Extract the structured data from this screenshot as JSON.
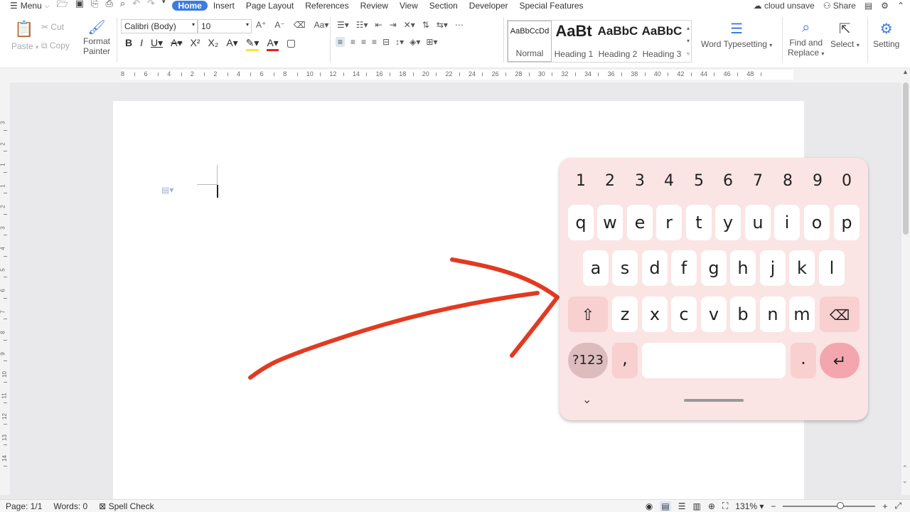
{
  "menubar": {
    "menu_label": "Menu",
    "tabs": [
      "Home",
      "Insert",
      "Page Layout",
      "References",
      "Review",
      "View",
      "Section",
      "Developer",
      "Special Features"
    ],
    "cloud_label": "cloud unsave",
    "share_label": "Share"
  },
  "ribbon": {
    "paste": "Paste",
    "cut": "Cut",
    "copy": "Copy",
    "format_painter_1": "Format",
    "format_painter_2": "Painter",
    "font_name": "Calibri (Body)",
    "font_size": "10",
    "styles": [
      {
        "sample": "AaBbCcDd",
        "label": "Normal"
      },
      {
        "sample": "AaBt",
        "label": "Heading 1"
      },
      {
        "sample": "AaBbC",
        "label": "Heading 2"
      },
      {
        "sample": "AaBbC",
        "label": "Heading 3"
      }
    ],
    "word_typesetting": "Word Typesetting",
    "find_replace_1": "Find and",
    "find_replace_2": "Replace",
    "select": "Select",
    "setting": "Setting"
  },
  "hruler": [
    "8",
    "6",
    "4",
    "2",
    "2",
    "4",
    "6",
    "8",
    "10",
    "12",
    "14",
    "16",
    "18",
    "20",
    "22",
    "24",
    "26",
    "28",
    "30",
    "32",
    "34",
    "36",
    "38",
    "40",
    "42",
    "44",
    "46",
    "48"
  ],
  "vruler": [
    "3",
    "2",
    "1",
    "1",
    "2",
    "3",
    "4",
    "5",
    "6",
    "7",
    "8",
    "9",
    "10",
    "11",
    "12",
    "13",
    "14"
  ],
  "keyboard": {
    "numbers": [
      "1",
      "2",
      "3",
      "4",
      "5",
      "6",
      "7",
      "8",
      "9",
      "0"
    ],
    "row1": [
      "q",
      "w",
      "e",
      "r",
      "t",
      "y",
      "u",
      "i",
      "o",
      "p"
    ],
    "row2": [
      "a",
      "s",
      "d",
      "f",
      "g",
      "h",
      "j",
      "k",
      "l"
    ],
    "row3": [
      "z",
      "x",
      "c",
      "v",
      "b",
      "n",
      "m"
    ],
    "sym_label": "?123",
    "comma": ",",
    "period": "."
  },
  "status": {
    "page": "Page: 1/1",
    "words": "Words: 0",
    "spell_check": "Spell Check",
    "zoom": "131%",
    "zoom_level": 0.62
  },
  "colors": {
    "tab_active": "#3c7ce0",
    "arrow": "#e23a21",
    "keyboard_bg": "#fbe4e4",
    "enter_key": "#f3a6ae"
  }
}
